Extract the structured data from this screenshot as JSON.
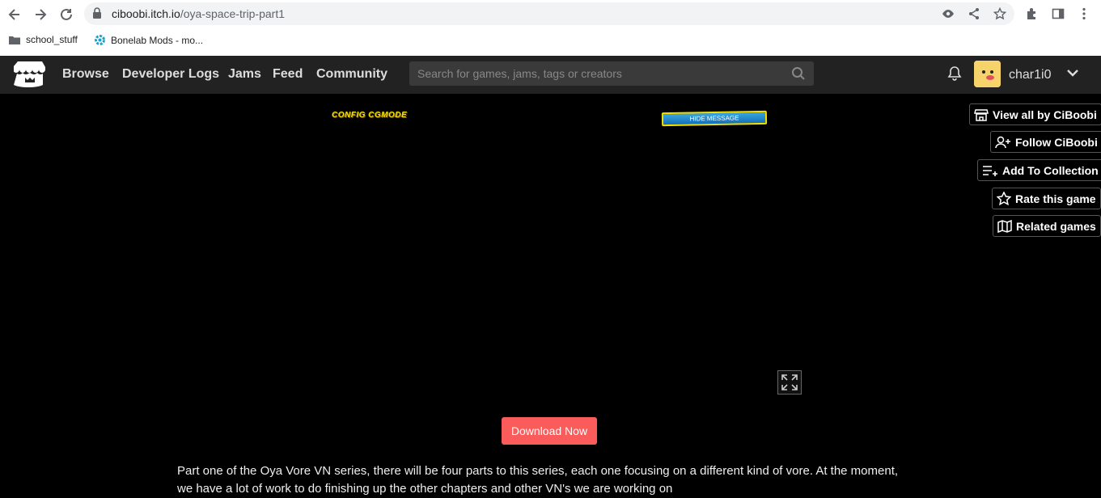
{
  "browser": {
    "url_host": "ciboobi.itch.io",
    "url_path": "/oya-space-trip-part1",
    "bookmarks": [
      {
        "label": "school_stuff",
        "icon": "folder-icon"
      },
      {
        "label": "Bonelab Mods - mo...",
        "icon": "gear-icon"
      }
    ]
  },
  "itch": {
    "nav": [
      "Browse",
      "Developer Logs",
      "Jams",
      "Feed",
      "Community"
    ],
    "search_placeholder": "Search for games, jams, tags or creators",
    "username": "char1i0"
  },
  "game": {
    "config_text": "CONFIG  CGMODE",
    "hide_message": "HIDE MESSAGE"
  },
  "actions": {
    "view_all": "View all by CiBoobi",
    "follow": "Follow CiBoobi",
    "add_collection": "Add To Collection",
    "rate": "Rate this game",
    "related": "Related games"
  },
  "download_label": "Download Now",
  "description": "Part one of the Oya Vore VN series, there will be four parts to this series, each one focusing on a different kind of vore. At the moment, we have a lot of work to do finishing up the other chapters and other VN's we are working on",
  "colors": {
    "header_bg": "#222222",
    "download_btn": "#fa5c5c",
    "accent_yellow": "#f6e000"
  }
}
